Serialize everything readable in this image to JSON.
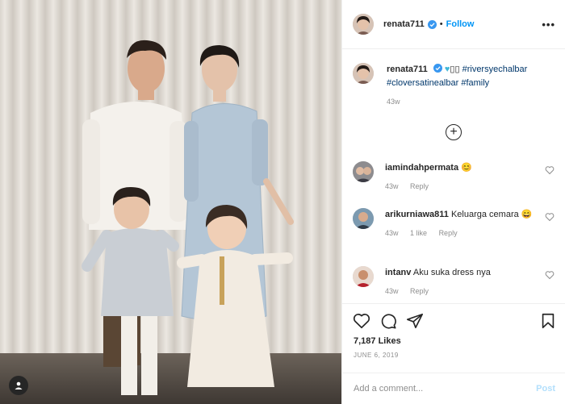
{
  "post": {
    "author": "renata711",
    "follow_label": "Follow",
    "separator": "•",
    "more_label": "•••",
    "caption": {
      "username": "renata711",
      "emoji": "♥",
      "emoji_rest": "▯▯ ",
      "hashtags": [
        "#riversyechalbar",
        "#cloversatinealbar",
        "#family"
      ],
      "age": "43w"
    },
    "load_more_label": "+",
    "comments": [
      {
        "username": "iamindahpermata",
        "text": "",
        "emoji": "😊",
        "age": "43w",
        "likes": "",
        "reply": "Reply"
      },
      {
        "username": "arikurniawa811",
        "text": "Keluarga cemara",
        "emoji": "😄",
        "age": "43w",
        "likes": "1 like",
        "reply": "Reply"
      },
      {
        "username": "intanv",
        "text": "Aku suka dress nya",
        "emoji": "",
        "age": "43w",
        "likes": "",
        "reply": "Reply"
      }
    ],
    "likes": "7,187 Likes",
    "date": "JUNE 6, 2019",
    "add_comment_placeholder": "Add a comment...",
    "post_label": "Post"
  },
  "icons": {
    "verified": "verified-badge-icon",
    "heart": "heart-icon",
    "comment": "comment-icon",
    "share": "share-icon",
    "save": "bookmark-icon",
    "tag": "user-tag-icon",
    "add": "plus-circle-icon"
  },
  "colors": {
    "accent": "#0095f6",
    "post_disabled": "#b2dffc",
    "hashtag": "#00376b",
    "muted": "#8e8e8e"
  }
}
